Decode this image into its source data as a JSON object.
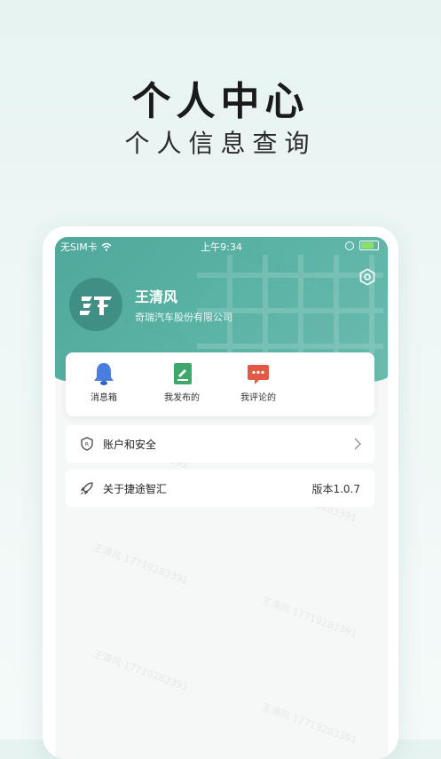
{
  "promo": {
    "title": "个人中心",
    "subtitle": "个人信息查询"
  },
  "status_bar": {
    "carrier": "无SIM卡",
    "time": "上午9:34"
  },
  "profile": {
    "name": "王清风",
    "company": "奇瑞汽车股份有限公司"
  },
  "shortcuts": [
    {
      "label": "消息箱",
      "icon": "bell-icon"
    },
    {
      "label": "我发布的",
      "icon": "document-icon"
    },
    {
      "label": "我评论的",
      "icon": "comment-icon"
    }
  ],
  "menu": {
    "account": {
      "label": "账户和安全",
      "icon": "shield-icon"
    },
    "about": {
      "label": "关于捷途智汇",
      "icon": "rocket-icon",
      "version": "版本1.0.7"
    }
  },
  "watermark": "王清风 17719283391",
  "colors": {
    "header": "#5bb3a5",
    "bell": "#4a7de0",
    "document": "#3ea86a",
    "comment": "#e25a45"
  }
}
